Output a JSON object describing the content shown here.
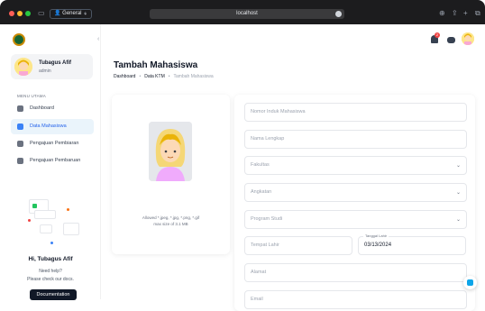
{
  "browser": {
    "profile_label": "General",
    "url": "localhost"
  },
  "user": {
    "name": "Tubagus Afif",
    "role": "admin"
  },
  "sidebar": {
    "menu_title": "MENU UTAMA",
    "items": [
      {
        "label": "Dashboard",
        "icon": "dashboard-icon",
        "active": false
      },
      {
        "label": "Data Mahasiswa",
        "icon": "students-icon",
        "active": true
      },
      {
        "label": "Pengajuan Pembiaran",
        "icon": "submission-icon",
        "active": false
      },
      {
        "label": "Pengajuan Pembaruan",
        "icon": "renewal-icon",
        "active": false
      }
    ],
    "help": {
      "title": "Hi, Tubagus Afif",
      "line1": "Need help?",
      "line2": "Please check our docs.",
      "button": "Documentation"
    }
  },
  "topbar": {
    "notification_count": "2"
  },
  "main": {
    "title": "Tambah Mahasiswa",
    "breadcrumb": [
      "Dashboard",
      "Data KTM",
      "Tambah Mahasiswa"
    ],
    "photo_caption_1": "Allowed *.jpeg, *.jpg, *.png, *.gif",
    "photo_caption_2": "max size of 3.1 MB"
  },
  "form": {
    "nim_placeholder": "Nomor Induk Mahasiswa",
    "name_placeholder": "Nama Lengkap",
    "faculty_placeholder": "Fakultas",
    "batch_placeholder": "Angkatan",
    "program_placeholder": "Program Studi",
    "birthplace_placeholder": "Tempat Lahir",
    "birthdate_label": "Tanggal Lahir",
    "birthdate_value": "03/13/2024",
    "address_placeholder": "Alamat",
    "email_placeholder": "Email"
  },
  "colors": {
    "accent": "#2563eb",
    "active_bg": "#eaf4fb",
    "badge": "#ef4444",
    "dark_button": "#111827"
  }
}
